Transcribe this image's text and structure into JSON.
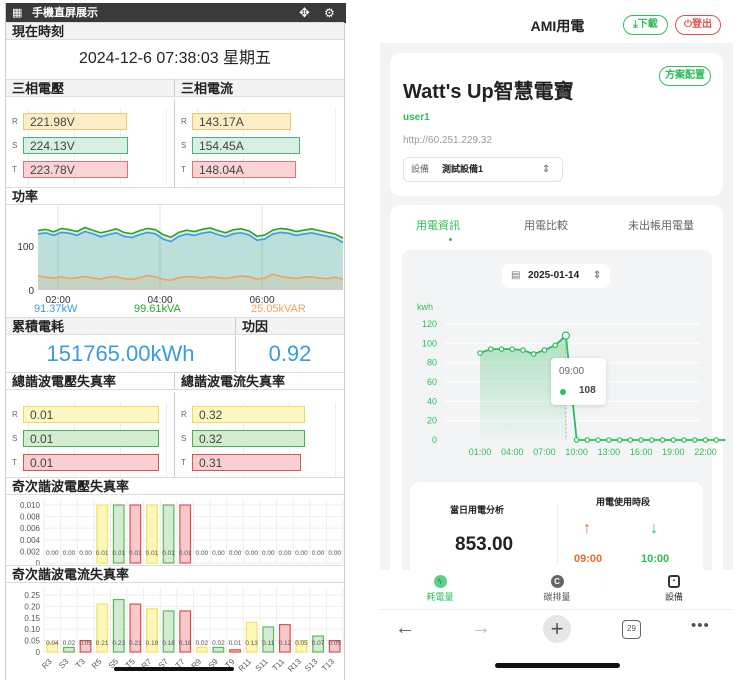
{
  "left": {
    "title": "手機直屏展示",
    "clock": {
      "heading": "現在時刻",
      "value": "2024-12-6 07:38:03 星期五"
    },
    "voltage": {
      "heading": "三相電壓",
      "rows": [
        {
          "phase": "R",
          "value": "221.98V",
          "fraction": 0.74
        },
        {
          "phase": "S",
          "value": "224.13V",
          "fraction": 0.75
        },
        {
          "phase": "T",
          "value": "223.78V",
          "fraction": 0.75
        }
      ]
    },
    "current": {
      "heading": "三相電流",
      "rows": [
        {
          "phase": "R",
          "value": "143.17A",
          "fraction": 0.71
        },
        {
          "phase": "S",
          "value": "154.45A",
          "fraction": 0.77
        },
        {
          "phase": "T",
          "value": "148.04A",
          "fraction": 0.74
        }
      ]
    },
    "power": {
      "heading": "功率",
      "legend": [
        {
          "label": "91.37kW",
          "color": "#3a9be0"
        },
        {
          "label": "99.61kVA",
          "color": "#2ca02c"
        },
        {
          "label": "25.05kVAR",
          "color": "#f0a060"
        }
      ]
    },
    "energy": {
      "heading": "累積電耗",
      "value": "151765.00kWh"
    },
    "pf": {
      "heading": "功因",
      "value": "0.92"
    },
    "thdv": {
      "heading": "總諧波電壓失真率",
      "rows": [
        {
          "phase": "R",
          "value": "0.01",
          "fraction": 0.97
        },
        {
          "phase": "S",
          "value": "0.01",
          "fraction": 0.97
        },
        {
          "phase": "T",
          "value": "0.01",
          "fraction": 0.97
        }
      ]
    },
    "thdi": {
      "heading": "總諧波電流失真率",
      "rows": [
        {
          "phase": "R",
          "value": "0.32",
          "fraction": 0.81
        },
        {
          "phase": "S",
          "value": "0.32",
          "fraction": 0.81
        },
        {
          "phase": "T",
          "value": "0.31",
          "fraction": 0.78
        }
      ]
    },
    "hv_heading": "奇次諧波電壓失真率",
    "hi_heading": "奇次諧波電流失真率"
  },
  "right": {
    "title": "AMI用電",
    "download": "下載",
    "logout": "登出",
    "brand": "Watt's Up智慧電寶",
    "plan_button": "方案配置",
    "user": "user1",
    "url": "http://60.251.229.32",
    "device_label": "設備",
    "device_value": "測試設備1",
    "tabs": [
      {
        "label": "用電資訊",
        "active": true
      },
      {
        "label": "用電比較",
        "active": false
      },
      {
        "label": "未出帳用電量",
        "active": false
      }
    ],
    "date": "2025-01-14",
    "tooltip": {
      "time": "09:00",
      "value": "108"
    },
    "daily_label": "當日用電分析",
    "daily_value": "853.00",
    "period_label": "用電使用時段",
    "peak_up": "09:00",
    "peak_down": "10:00",
    "nav": [
      {
        "label": "耗電量",
        "active": true
      },
      {
        "label": "碳排量",
        "active": false
      },
      {
        "label": "設備",
        "active": false
      }
    ],
    "browser": {
      "tabs_count": "29"
    }
  },
  "colors": {
    "green": "#2dbd5a",
    "red": "#e05050",
    "orange": "#f06a2a"
  },
  "chart_data": [
    {
      "type": "line",
      "title": "功率",
      "x_ticks": [
        "02:00",
        "04:00",
        "06:00"
      ],
      "y_ticks": [
        "0",
        "100"
      ],
      "ylim": [
        0,
        185
      ],
      "series": [
        {
          "name": "kVA",
          "color": "#2ca02c",
          "values": [
            135,
            138,
            132,
            140,
            137,
            133,
            142,
            136,
            130,
            134,
            139,
            131,
            128,
            135,
            140,
            137,
            126,
            120,
            131,
            136,
            133,
            138,
            141,
            135,
            130,
            137,
            139,
            134,
            122,
            125,
            136,
            140,
            138,
            133,
            136,
            139,
            135,
            131,
            127,
            118
          ]
        },
        {
          "name": "kW",
          "color": "#3a9be0",
          "values": [
            127,
            130,
            124,
            131,
            129,
            124,
            133,
            128,
            121,
            126,
            130,
            122,
            119,
            126,
            131,
            128,
            116,
            110,
            122,
            127,
            124,
            129,
            132,
            126,
            121,
            128,
            130,
            125,
            113,
            116,
            127,
            131,
            129,
            124,
            127,
            130,
            126,
            122,
            118,
            108
          ]
        },
        {
          "name": "kVAR",
          "color": "#f0a060",
          "values": [
            32,
            29,
            27,
            30,
            26,
            28,
            31,
            27,
            25,
            29,
            30,
            26,
            24,
            28,
            33,
            30,
            24,
            22,
            28,
            31,
            29,
            27,
            30,
            28,
            26,
            29,
            32,
            30,
            25,
            27,
            36,
            31,
            28,
            26,
            29,
            30,
            27,
            26,
            29,
            24
          ]
        }
      ]
    },
    {
      "type": "bar",
      "title": "奇次諧波電壓失真率",
      "categories": [
        "R3",
        "S3",
        "T3",
        "R5",
        "S5",
        "T5",
        "R7",
        "S7",
        "T7",
        "R9",
        "S9",
        "T9",
        "R11",
        "S11",
        "T11",
        "R13",
        "S13",
        "T13"
      ],
      "values": [
        0,
        0,
        0,
        0.01,
        0.01,
        0.01,
        0.01,
        0.01,
        0.01,
        0,
        0,
        0,
        0,
        0,
        0,
        0,
        0,
        0
      ],
      "labels": [
        "0.00",
        "0.00",
        "0.00",
        "0.01",
        "0.01",
        "0.01",
        "0.01",
        "0.01",
        "0.01",
        "0.00",
        "0.00",
        "0.00",
        "0.00",
        "0.00",
        "0.00",
        "0.00",
        "0.00",
        "0.00"
      ],
      "y_ticks": [
        "0",
        "0.002",
        "0.004",
        "0.006",
        "0.008",
        "0.010"
      ],
      "ylim": [
        0,
        0.01
      ]
    },
    {
      "type": "bar",
      "title": "奇次諧波電流失真率",
      "categories": [
        "R3",
        "S3",
        "T3",
        "R5",
        "S5",
        "T5",
        "R7",
        "S7",
        "T7",
        "R9",
        "S9",
        "T9",
        "R11",
        "S11",
        "T11",
        "R13",
        "S13",
        "T13"
      ],
      "values": [
        0.04,
        0.02,
        0.05,
        0.21,
        0.23,
        0.21,
        0.19,
        0.18,
        0.18,
        0.02,
        0.02,
        0.01,
        0.13,
        0.11,
        0.12,
        0.05,
        0.07,
        0.05
      ],
      "labels": [
        "0.04",
        "0.02",
        "0.05",
        "0.21",
        "0.23",
        "0.21",
        "0.19",
        "0.18",
        "0.18",
        "0.02",
        "0.02",
        "0.01",
        "0.13",
        "0.11",
        "0.12",
        "0.05",
        "0.07",
        "0.05"
      ],
      "y_ticks": [
        "0",
        "0.05",
        "0.10",
        "0.15",
        "0.20",
        "0.25"
      ],
      "ylim": [
        0,
        0.25
      ]
    },
    {
      "type": "line",
      "title": "kwh",
      "ylabel": "kwh",
      "x": [
        "01:00",
        "02:00",
        "03:00",
        "04:00",
        "05:00",
        "06:00",
        "07:00",
        "08:00",
        "09:00",
        "10:00",
        "11:00",
        "12:00",
        "13:00",
        "14:00",
        "15:00",
        "16:00",
        "17:00",
        "18:00",
        "19:00",
        "20:00",
        "21:00",
        "22:00",
        "23:00",
        "24:00"
      ],
      "values": [
        90,
        94,
        94,
        94,
        93,
        89,
        93,
        98,
        108,
        0,
        0,
        0,
        0,
        0,
        0,
        0,
        0,
        0,
        0,
        0,
        0,
        0,
        0,
        0
      ],
      "x_ticks": [
        "01:00",
        "04:00",
        "07:00",
        "10:00",
        "13:00",
        "16:00",
        "19:00",
        "22:00"
      ],
      "y_ticks": [
        "0",
        "20",
        "40",
        "60",
        "80",
        "100",
        "120"
      ],
      "ylim": [
        0,
        120
      ]
    }
  ]
}
